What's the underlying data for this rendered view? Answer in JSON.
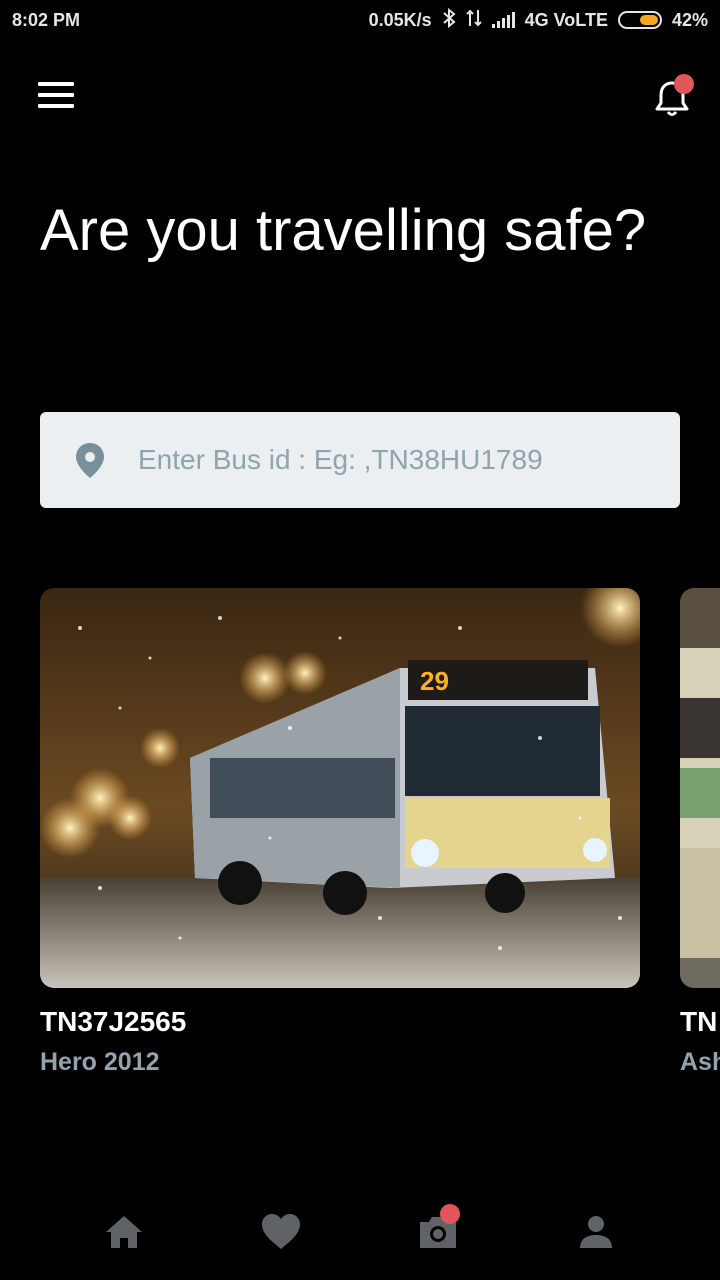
{
  "status_bar": {
    "time": "8:02 PM",
    "net_speed": "0.05K/s",
    "network": "4G VoLTE",
    "battery": "42%",
    "battery_color": "#f5a623"
  },
  "header": {
    "menu_icon": "hamburger-menu-icon",
    "notification_icon": "bell-icon",
    "badge_color": "#e0565b"
  },
  "hero": {
    "title": "Are you travelling safe?"
  },
  "search": {
    "icon": "location-pin-icon",
    "placeholder": "Enter Bus id : Eg: ,TN38HU1789",
    "value": ""
  },
  "cards": [
    {
      "title": "TN37J2565",
      "subtitle": "Hero 2012",
      "image": "bus-at-night-snow-photo"
    },
    {
      "title": "TN",
      "subtitle": "Ash",
      "image": "tram-photo"
    }
  ],
  "bottom_nav": [
    {
      "name": "home",
      "icon": "home-icon"
    },
    {
      "name": "favorites",
      "icon": "heart-icon"
    },
    {
      "name": "camera",
      "icon": "camera-icon"
    },
    {
      "name": "profile",
      "icon": "person-icon"
    }
  ]
}
